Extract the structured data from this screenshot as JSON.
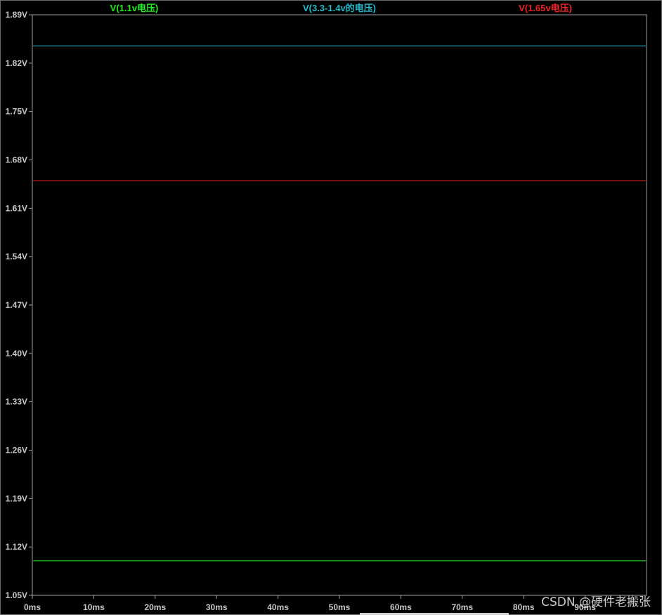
{
  "chart_data": {
    "type": "line",
    "x": [
      0,
      90
    ],
    "xlabel": "",
    "ylabel": "",
    "xlim": [
      0,
      100
    ],
    "ylim": [
      1.05,
      1.89
    ],
    "grid": false,
    "legend": "top",
    "x_ticks": [
      "0ms",
      "10ms",
      "20ms",
      "30ms",
      "40ms",
      "50ms",
      "60ms",
      "70ms",
      "80ms",
      "90ms"
    ],
    "y_ticks": [
      "1.89V",
      "1.82V",
      "1.75V",
      "1.68V",
      "1.61V",
      "1.54V",
      "1.47V",
      "1.40V",
      "1.33V",
      "1.26V",
      "1.19V",
      "1.12V",
      "1.05V"
    ],
    "series": [
      {
        "name": "V(1.1v电压)",
        "color": "#22ee22",
        "values": [
          1.1,
          1.1
        ]
      },
      {
        "name": "V(3.3-1.4v的电压)",
        "color": "#22bbcc",
        "values": [
          1.845,
          1.845
        ]
      },
      {
        "name": "V(1.65v电压)",
        "color": "#ee2222",
        "values": [
          1.65,
          1.65
        ]
      }
    ]
  },
  "watermark": "CSDN @硬件老搬张",
  "colors": {
    "axis": "#a0a0a0",
    "background": "#000000",
    "tick_text": "#c8c8c8"
  }
}
